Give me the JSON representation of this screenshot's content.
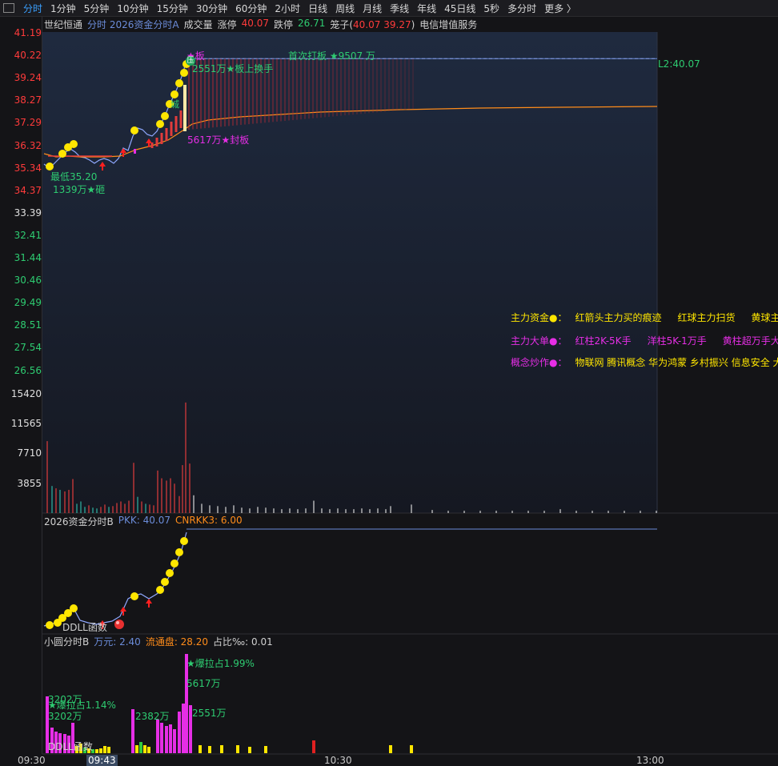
{
  "toolbar": {
    "tabs": [
      "分时",
      "1分钟",
      "5分钟",
      "10分钟",
      "15分钟",
      "30分钟",
      "60分钟",
      "2小时",
      "日线",
      "周线",
      "月线",
      "季线",
      "年线",
      "45日线",
      "5秒",
      "多分时",
      "更多 〉"
    ],
    "active": "分时"
  },
  "info": {
    "stock": "世纪恒通",
    "mode": "分时 2026资金分时A",
    "volume_label": "成交量",
    "limit_up_label": "涨停",
    "limit_up": "40.07",
    "limit_down_label": "跌停",
    "limit_down": "26.71",
    "cage_label": "笼子(",
    "cage_high": "40.07",
    "cage_low": "39.27",
    "cage_close": ")",
    "concept": "电信增值服务"
  },
  "price_axis": {
    "labels": [
      "41.19",
      "40.22",
      "39.24",
      "38.27",
      "37.29",
      "36.32",
      "35.34",
      "34.37",
      "33.39",
      "32.41",
      "31.44",
      "30.46",
      "29.49",
      "28.51",
      "27.54",
      "26.56"
    ],
    "base": "33.39"
  },
  "volume_axis": [
    "15420",
    "11565",
    "7710",
    "3855"
  ],
  "price_annotations": {
    "first_limit": "首次打板 ★9507 万",
    "board_mark": "★板",
    "pressure_mark": "压",
    "turnover": "2551万★板上换手",
    "seal": "5617万★封板",
    "low_price": "最低35.20",
    "smash": "1339万★砸",
    "wall_mark": "城",
    "right_label": "L2:40.07"
  },
  "legend": {
    "row1_key": "主力资金●：",
    "row1": [
      "红箭头主力买的痕迹",
      "红球主力扫货",
      "黄球主"
    ],
    "row2_key": "主力大单●：",
    "row2": [
      "红柱2K-5K手",
      "洋柱5K-1万手",
      "黄柱超万手大"
    ],
    "row3_key": "概念炒作●：",
    "row3": "物联网 腾讯概念 华为鸿蒙 乡村振兴 信息安全 大数"
  },
  "panel_b": {
    "title": "2026资金分时B",
    "pkk": "PKK: 40.07",
    "cnrkk": "CNRKK3: 6.00",
    "func_label": "DDLL函数"
  },
  "panel_c": {
    "title": "小圆分时B",
    "wanyuan": "万元: 2.40",
    "float": "流通盘: 28.20",
    "ratio": "占比‰: 0.01",
    "ann1": "3202万",
    "ann2": "★爆拉占1.14%",
    "ann3": "3202万",
    "ann4": "2382万",
    "ann5": "★爆拉占1.99%",
    "ann6": "5617万",
    "ann7": "2551万",
    "func_label": "DDLL函数"
  },
  "time_axis": {
    "t1": "09:30",
    "t2": "09:43",
    "t3": "10:30",
    "t4": "13:00"
  },
  "colors": {
    "price_line": "#8fa8ff",
    "avg_line": "#ff8c1a",
    "limit_line": "#6b8cd9",
    "up_red": "#e23c3c",
    "down_cyan": "#2fb5a5",
    "magenta": "#e62ee6",
    "yellow": "#ffe600"
  }
}
